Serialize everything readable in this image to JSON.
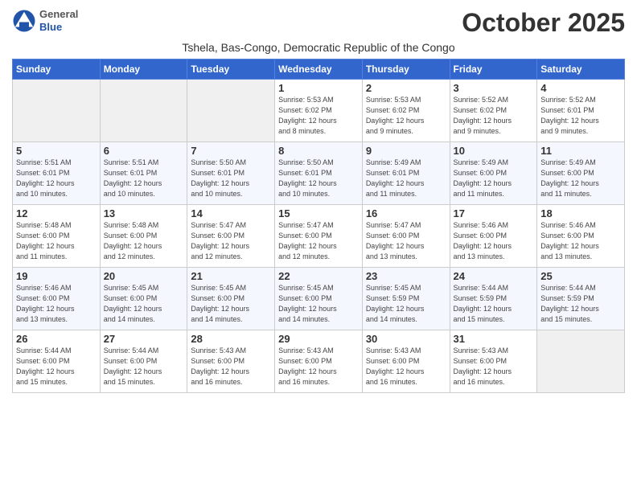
{
  "header": {
    "logo_general": "General",
    "logo_blue": "Blue",
    "month_title": "October 2025",
    "subtitle": "Tshela, Bas-Congo, Democratic Republic of the Congo"
  },
  "days_of_week": [
    "Sunday",
    "Monday",
    "Tuesday",
    "Wednesday",
    "Thursday",
    "Friday",
    "Saturday"
  ],
  "weeks": [
    [
      {
        "day": "",
        "info": ""
      },
      {
        "day": "",
        "info": ""
      },
      {
        "day": "",
        "info": ""
      },
      {
        "day": "1",
        "info": "Sunrise: 5:53 AM\nSunset: 6:02 PM\nDaylight: 12 hours\nand 8 minutes."
      },
      {
        "day": "2",
        "info": "Sunrise: 5:53 AM\nSunset: 6:02 PM\nDaylight: 12 hours\nand 9 minutes."
      },
      {
        "day": "3",
        "info": "Sunrise: 5:52 AM\nSunset: 6:02 PM\nDaylight: 12 hours\nand 9 minutes."
      },
      {
        "day": "4",
        "info": "Sunrise: 5:52 AM\nSunset: 6:01 PM\nDaylight: 12 hours\nand 9 minutes."
      }
    ],
    [
      {
        "day": "5",
        "info": "Sunrise: 5:51 AM\nSunset: 6:01 PM\nDaylight: 12 hours\nand 10 minutes."
      },
      {
        "day": "6",
        "info": "Sunrise: 5:51 AM\nSunset: 6:01 PM\nDaylight: 12 hours\nand 10 minutes."
      },
      {
        "day": "7",
        "info": "Sunrise: 5:50 AM\nSunset: 6:01 PM\nDaylight: 12 hours\nand 10 minutes."
      },
      {
        "day": "8",
        "info": "Sunrise: 5:50 AM\nSunset: 6:01 PM\nDaylight: 12 hours\nand 10 minutes."
      },
      {
        "day": "9",
        "info": "Sunrise: 5:49 AM\nSunset: 6:01 PM\nDaylight: 12 hours\nand 11 minutes."
      },
      {
        "day": "10",
        "info": "Sunrise: 5:49 AM\nSunset: 6:00 PM\nDaylight: 12 hours\nand 11 minutes."
      },
      {
        "day": "11",
        "info": "Sunrise: 5:49 AM\nSunset: 6:00 PM\nDaylight: 12 hours\nand 11 minutes."
      }
    ],
    [
      {
        "day": "12",
        "info": "Sunrise: 5:48 AM\nSunset: 6:00 PM\nDaylight: 12 hours\nand 11 minutes."
      },
      {
        "day": "13",
        "info": "Sunrise: 5:48 AM\nSunset: 6:00 PM\nDaylight: 12 hours\nand 12 minutes."
      },
      {
        "day": "14",
        "info": "Sunrise: 5:47 AM\nSunset: 6:00 PM\nDaylight: 12 hours\nand 12 minutes."
      },
      {
        "day": "15",
        "info": "Sunrise: 5:47 AM\nSunset: 6:00 PM\nDaylight: 12 hours\nand 12 minutes."
      },
      {
        "day": "16",
        "info": "Sunrise: 5:47 AM\nSunset: 6:00 PM\nDaylight: 12 hours\nand 13 minutes."
      },
      {
        "day": "17",
        "info": "Sunrise: 5:46 AM\nSunset: 6:00 PM\nDaylight: 12 hours\nand 13 minutes."
      },
      {
        "day": "18",
        "info": "Sunrise: 5:46 AM\nSunset: 6:00 PM\nDaylight: 12 hours\nand 13 minutes."
      }
    ],
    [
      {
        "day": "19",
        "info": "Sunrise: 5:46 AM\nSunset: 6:00 PM\nDaylight: 12 hours\nand 13 minutes."
      },
      {
        "day": "20",
        "info": "Sunrise: 5:45 AM\nSunset: 6:00 PM\nDaylight: 12 hours\nand 14 minutes."
      },
      {
        "day": "21",
        "info": "Sunrise: 5:45 AM\nSunset: 6:00 PM\nDaylight: 12 hours\nand 14 minutes."
      },
      {
        "day": "22",
        "info": "Sunrise: 5:45 AM\nSunset: 6:00 PM\nDaylight: 12 hours\nand 14 minutes."
      },
      {
        "day": "23",
        "info": "Sunrise: 5:45 AM\nSunset: 5:59 PM\nDaylight: 12 hours\nand 14 minutes."
      },
      {
        "day": "24",
        "info": "Sunrise: 5:44 AM\nSunset: 5:59 PM\nDaylight: 12 hours\nand 15 minutes."
      },
      {
        "day": "25",
        "info": "Sunrise: 5:44 AM\nSunset: 5:59 PM\nDaylight: 12 hours\nand 15 minutes."
      }
    ],
    [
      {
        "day": "26",
        "info": "Sunrise: 5:44 AM\nSunset: 6:00 PM\nDaylight: 12 hours\nand 15 minutes."
      },
      {
        "day": "27",
        "info": "Sunrise: 5:44 AM\nSunset: 6:00 PM\nDaylight: 12 hours\nand 15 minutes."
      },
      {
        "day": "28",
        "info": "Sunrise: 5:43 AM\nSunset: 6:00 PM\nDaylight: 12 hours\nand 16 minutes."
      },
      {
        "day": "29",
        "info": "Sunrise: 5:43 AM\nSunset: 6:00 PM\nDaylight: 12 hours\nand 16 minutes."
      },
      {
        "day": "30",
        "info": "Sunrise: 5:43 AM\nSunset: 6:00 PM\nDaylight: 12 hours\nand 16 minutes."
      },
      {
        "day": "31",
        "info": "Sunrise: 5:43 AM\nSunset: 6:00 PM\nDaylight: 12 hours\nand 16 minutes."
      },
      {
        "day": "",
        "info": ""
      }
    ]
  ]
}
